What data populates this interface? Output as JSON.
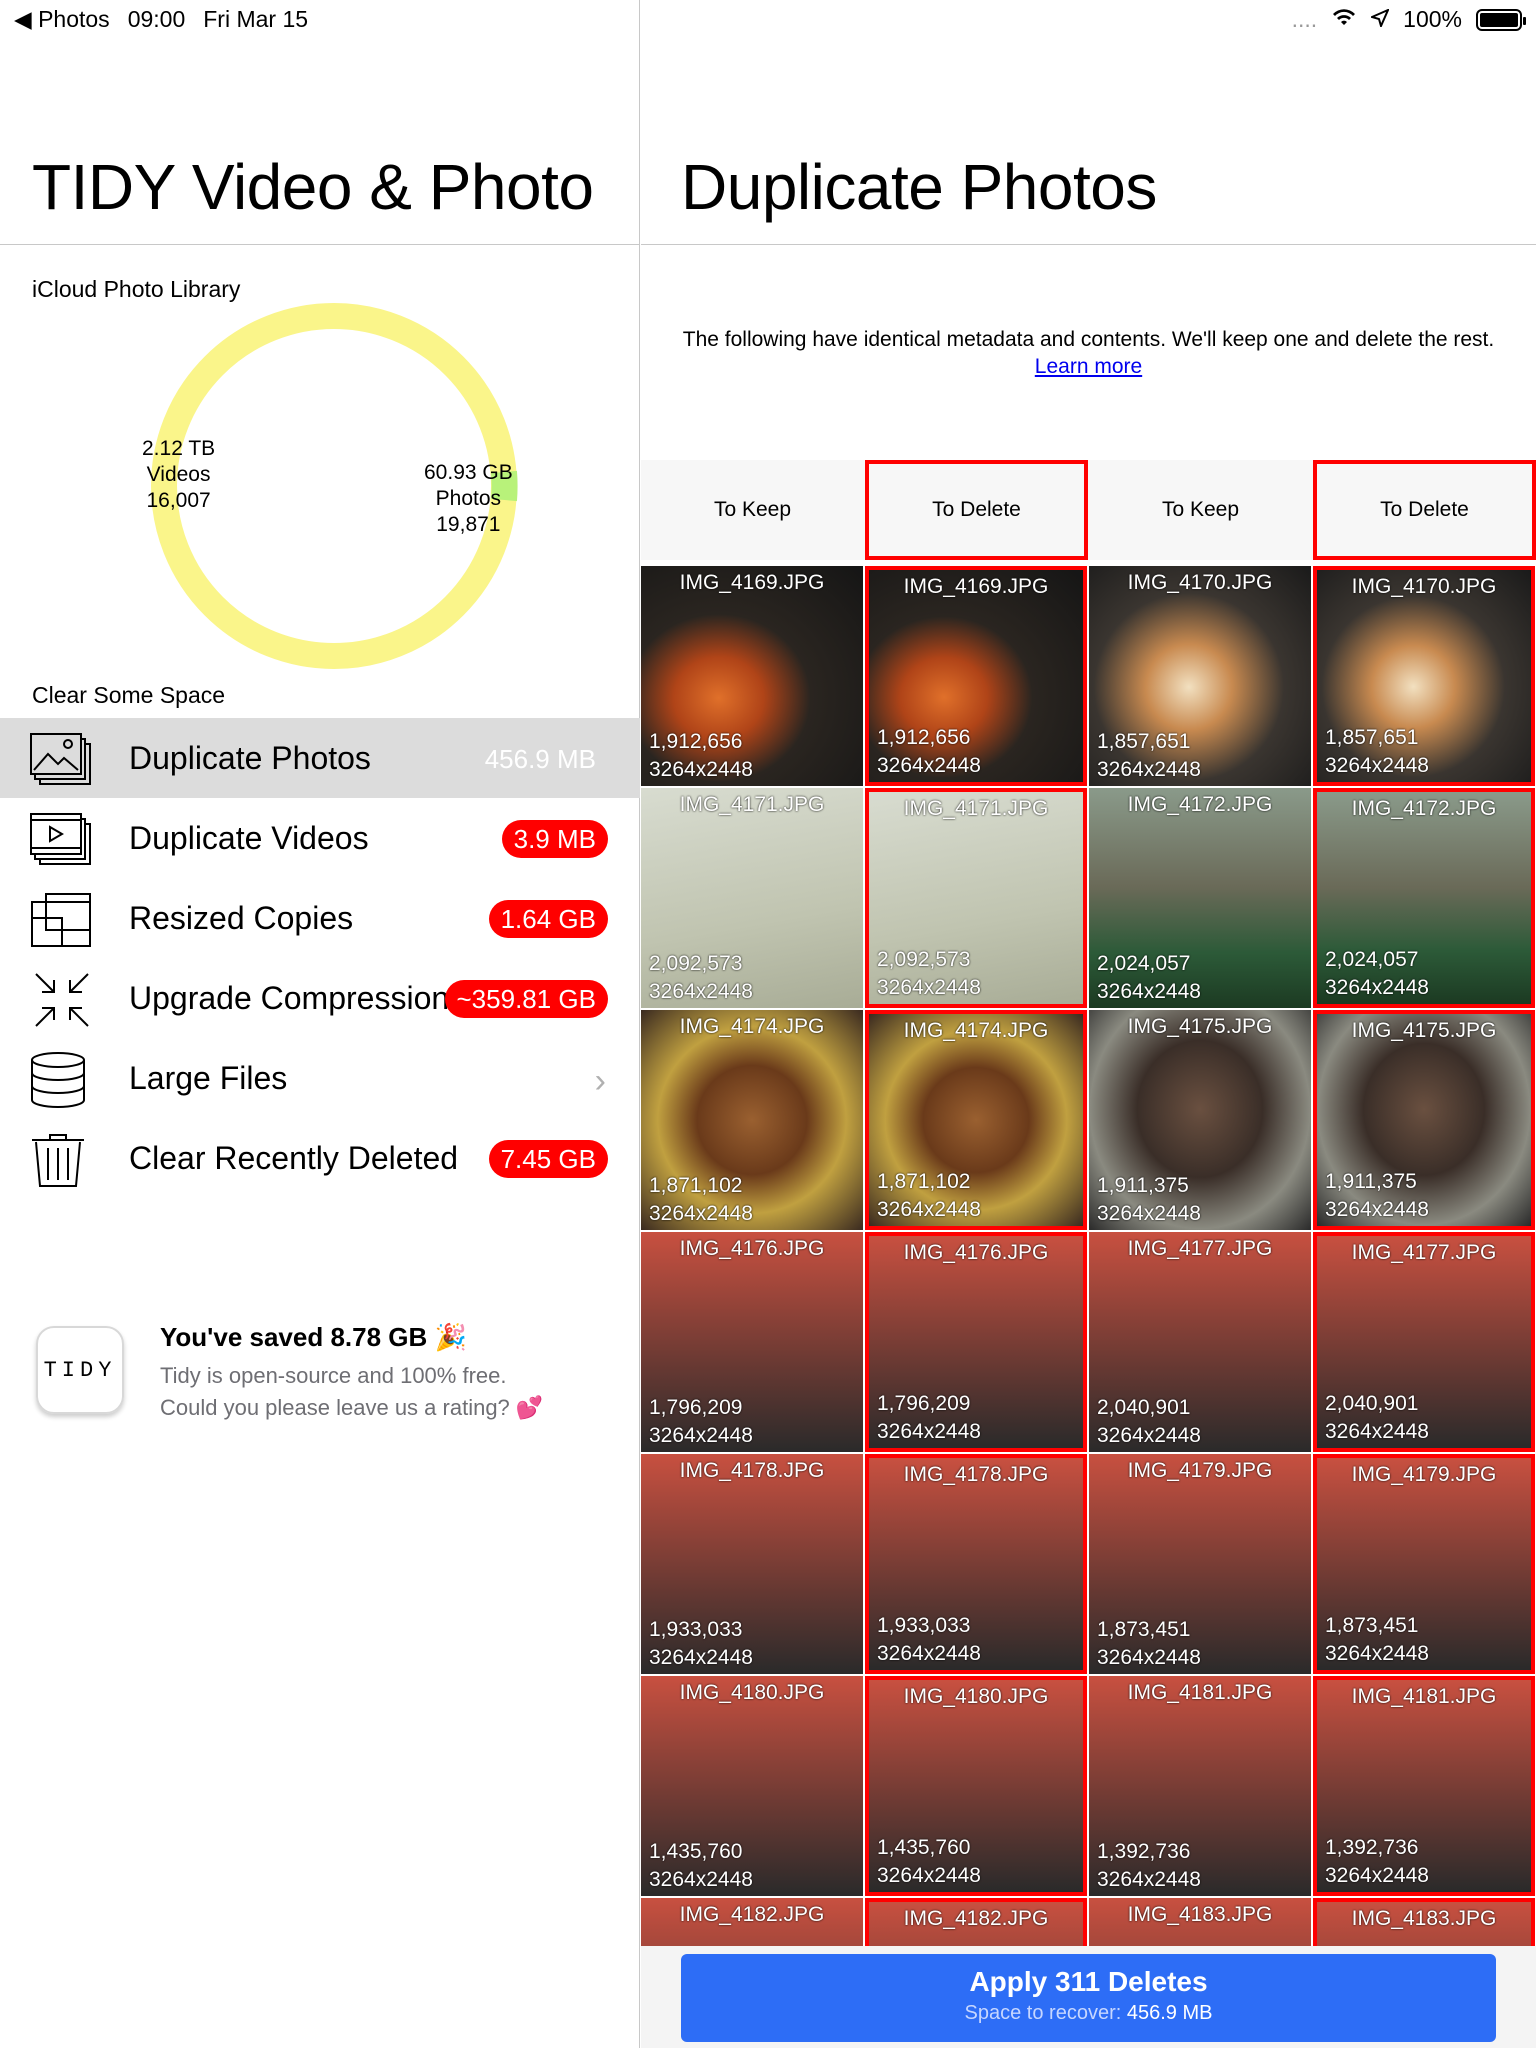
{
  "status": {
    "back": "Photos",
    "time": "09:00",
    "date": "Fri Mar 15",
    "signal": "....",
    "battery": "100%"
  },
  "left": {
    "title": "TIDY Video & Photo",
    "library_label": "iCloud Photo Library",
    "donut": {
      "videos_size": "2.12 TB",
      "videos_label": "Videos",
      "videos_count": "16,007",
      "photos_size": "60.93 GB",
      "photos_label": "Photos",
      "photos_count": "19,871",
      "ring_color": "#faf58a",
      "photo_color": "#b8f27a"
    },
    "clear_label": "Clear Some Space",
    "menu": [
      {
        "label": "Duplicate Photos",
        "value": "456.9 MB",
        "icon": "photos-stack-icon"
      },
      {
        "label": "Duplicate Videos",
        "value": "3.9 MB",
        "icon": "video-stack-icon"
      },
      {
        "label": "Resized Copies",
        "value": "1.64 GB",
        "icon": "resize-icon"
      },
      {
        "label": "Upgrade Compression",
        "value": "~359.81 GB",
        "icon": "compress-icon"
      },
      {
        "label": "Large Files",
        "value": "",
        "icon": "database-icon"
      },
      {
        "label": "Clear Recently Deleted",
        "value": "7.45 GB",
        "icon": "trash-icon"
      }
    ],
    "promo": {
      "logo": "TIDY",
      "title": "You've saved 8.78 GB 🎉",
      "line1": "Tidy is open-source and 100% free.",
      "line2": "Could you please leave us a rating? 💕"
    }
  },
  "right": {
    "title": "Duplicate Photos",
    "desc": "The following have identical metadata and contents. We'll keep one and delete the rest.",
    "learn_more": "Learn more",
    "columns": [
      "To Keep",
      "To Delete",
      "To Keep",
      "To Delete"
    ],
    "rows": [
      {
        "a": {
          "name": "IMG_4169.JPG",
          "size": "1,912,656",
          "dim": "3264x2448"
        },
        "b": {
          "name": "IMG_4170.JPG",
          "size": "1,857,651",
          "dim": "3264x2448"
        }
      },
      {
        "a": {
          "name": "IMG_4171.JPG",
          "size": "2,092,573",
          "dim": "3264x2448"
        },
        "b": {
          "name": "IMG_4172.JPG",
          "size": "2,024,057",
          "dim": "3264x2448"
        }
      },
      {
        "a": {
          "name": "IMG_4174.JPG",
          "size": "1,871,102",
          "dim": "3264x2448"
        },
        "b": {
          "name": "IMG_4175.JPG",
          "size": "1,911,375",
          "dim": "3264x2448"
        }
      },
      {
        "a": {
          "name": "IMG_4176.JPG",
          "size": "1,796,209",
          "dim": "3264x2448"
        },
        "b": {
          "name": "IMG_4177.JPG",
          "size": "2,040,901",
          "dim": "3264x2448"
        }
      },
      {
        "a": {
          "name": "IMG_4178.JPG",
          "size": "1,933,033",
          "dim": "3264x2448"
        },
        "b": {
          "name": "IMG_4179.JPG",
          "size": "1,873,451",
          "dim": "3264x2448"
        }
      },
      {
        "a": {
          "name": "IMG_4180.JPG",
          "size": "1,435,760",
          "dim": "3264x2448"
        },
        "b": {
          "name": "IMG_4181.JPG",
          "size": "1,392,736",
          "dim": "3264x2448"
        }
      },
      {
        "a": {
          "name": "IMG_4182.JPG",
          "size": "",
          "dim": ""
        },
        "b": {
          "name": "IMG_4183.JPG",
          "size": "",
          "dim": ""
        }
      }
    ],
    "apply": {
      "label": "Apply 311 Deletes",
      "sub_prefix": "Space to recover:",
      "sub_value": "456.9 MB"
    }
  }
}
